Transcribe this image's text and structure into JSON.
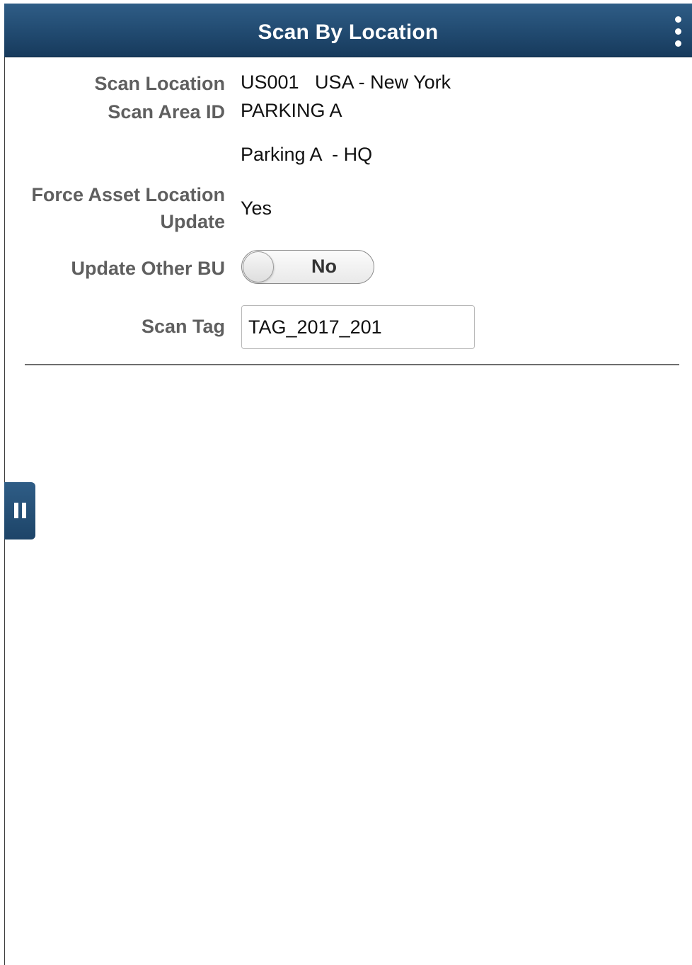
{
  "header": {
    "title": "Scan By Location",
    "actions_icon": "kebab-menu-icon"
  },
  "form": {
    "scan_location": {
      "label": "Scan Location",
      "value": "US001   USA - New York"
    },
    "scan_area_id": {
      "label": "Scan Area ID",
      "value": "PARKING A",
      "description": "Parking A  - HQ"
    },
    "force_asset_location_update": {
      "label_line1": "Force Asset Location",
      "label_line2": "Update",
      "value": "Yes"
    },
    "update_other_bu": {
      "label": "Update Other BU",
      "toggle_text": "No",
      "state": "off"
    },
    "scan_tag": {
      "label": "Scan Tag",
      "value": "TAG_2017_201"
    }
  },
  "side_panel": {
    "icon": "panel-toggle-icon"
  },
  "colors": {
    "header_bg": "#214a70",
    "label_text": "#5f5f5f",
    "value_text": "#111111"
  }
}
